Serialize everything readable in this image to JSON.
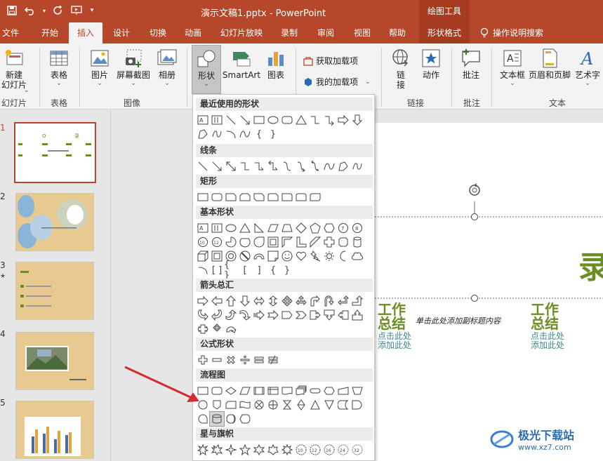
{
  "window": {
    "title": "演示文稿1.pptx  -  PowerPoint",
    "context_tool": "绘图工具"
  },
  "tabs": [
    "文件",
    "开始",
    "插入",
    "设计",
    "切换",
    "动画",
    "幻灯片放映",
    "录制",
    "审阅",
    "视图",
    "帮助",
    "形状格式"
  ],
  "active_tab": "插入",
  "tell_me": "操作说明搜索",
  "ribbon": {
    "new_slide": "新建\n幻灯片",
    "table": "表格",
    "picture": "图片",
    "screenshot": "屏幕截图",
    "album": "相册",
    "shapes": "形状",
    "smartart": "SmartArt",
    "chart": "图表",
    "get_addins": "获取加载项",
    "my_addins": "我的加载项",
    "link": "链\n接",
    "action": "动作",
    "comment": "批注",
    "textbox": "文本框",
    "header_footer": "页眉和页脚",
    "wordart": "艺术字",
    "groups": {
      "slides": "幻灯片",
      "tables": "表格",
      "images": "图像",
      "links": "链接",
      "comments": "批注",
      "text": "文本"
    }
  },
  "dropdown": {
    "sections": [
      "最近使用的形状",
      "线条",
      "矩形",
      "基本形状",
      "箭头总汇",
      "公式形状",
      "流程图",
      "星与旗帜"
    ]
  },
  "thumbnails": [
    {
      "num": "1",
      "active": true
    },
    {
      "num": "2",
      "active": false
    },
    {
      "num": "3",
      "active": false
    },
    {
      "num": "4",
      "active": false
    },
    {
      "num": "5",
      "active": false
    }
  ],
  "slide": {
    "title_left": "工作\n总结",
    "title_right": "工作\n总结",
    "center_text": "单击此处添加副标题内容",
    "sub_left": "点击此处\n添加此处",
    "sub_right": "点击此处\n添加此处",
    "big_char": "录"
  },
  "watermark": {
    "brand": "极光下载站",
    "url": "www.xz7.com"
  },
  "colors": {
    "accent": "#b7472a",
    "slide_green": "#6b8e23"
  }
}
